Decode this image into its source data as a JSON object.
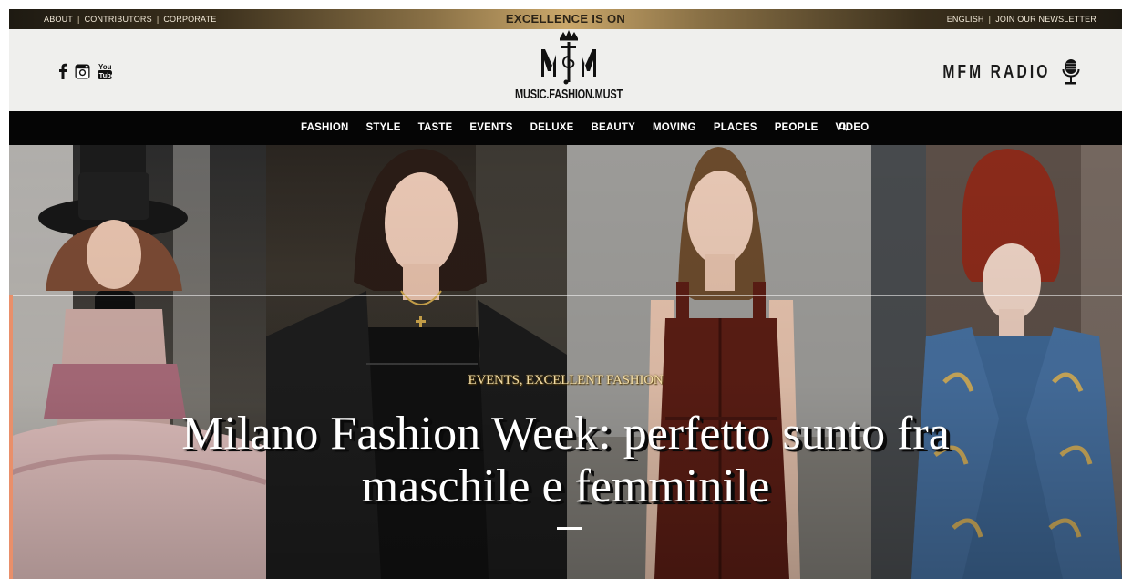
{
  "topbar": {
    "left_links": [
      "ABOUT",
      "CONTRIBUTORS",
      "CORPORATE"
    ],
    "separator": "|",
    "center_text": "EXCELLENCE IS ON",
    "right_links": [
      "ENGLISH",
      "JOIN OUR NEWSLETTER"
    ]
  },
  "header": {
    "social_icons": [
      "facebook-icon",
      "instagram-icon",
      "youtube-icon"
    ],
    "logo_monogram": "MFM",
    "logo_text": "MUSIC.FASHION.MUST",
    "radio_label": "MFM RADIO",
    "radio_icon": "microphone-icon"
  },
  "nav": {
    "items": [
      "FASHION",
      "STYLE",
      "TASTE",
      "EVENTS",
      "DELUXE",
      "BEAUTY",
      "MOVING",
      "PLACES",
      "PEOPLE",
      "VIDEO"
    ],
    "search_icon": "search-icon"
  },
  "hero": {
    "category": "EVENTS, EXCELLENT FASHION",
    "title_line1": "Milano Fashion Week: perfetto sunto fra",
    "title_line2": "maschile e femminile"
  },
  "colors": {
    "gold": "#caa76a",
    "nav_bg": "#050505",
    "header_bg": "#efefed",
    "category_gold": "#f1dca6"
  }
}
